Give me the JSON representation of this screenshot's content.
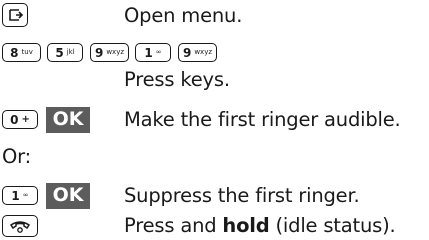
{
  "instructions": [
    {
      "icon": "menu-softkey-icon",
      "text": "Open menu."
    },
    {
      "keys": [
        {
          "main": "8",
          "sub": "tuv"
        },
        {
          "main": "5",
          "sub": "jkl"
        },
        {
          "main": "9",
          "sub": "wxyz"
        },
        {
          "main": "1",
          "sub": "∞"
        },
        {
          "main": "9",
          "sub": "wxyz"
        }
      ]
    },
    {
      "text": "Press keys."
    },
    {
      "key": {
        "main": "0",
        "sub": "+"
      },
      "ok": "OK",
      "text": "Make the first ringer audible."
    },
    {
      "text": "Or:"
    },
    {
      "key": {
        "main": "1",
        "sub": "∞"
      },
      "ok": "OK",
      "text": "Suppress the first ringer."
    },
    {
      "icon": "end-call-icon",
      "text_before": "Press and ",
      "text_bold": "hold",
      "text_after": " (idle status)."
    }
  ],
  "colors": {
    "text": "#1a1a1a",
    "ok_bg": "#5c5c5c",
    "ok_text": "#ffffff"
  }
}
